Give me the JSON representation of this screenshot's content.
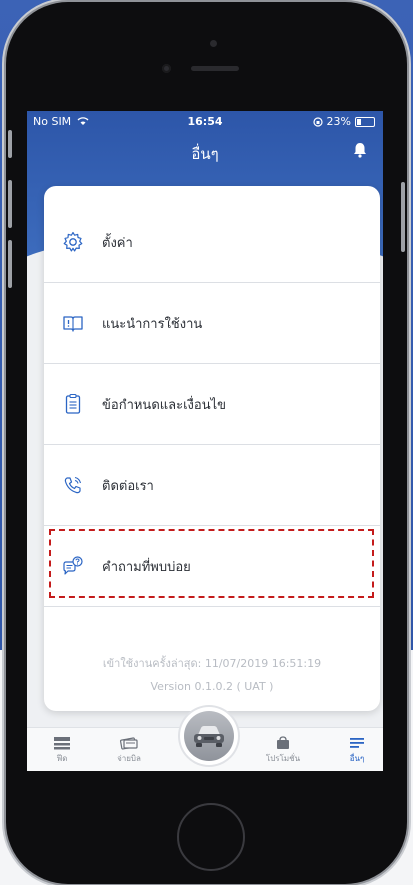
{
  "status_bar": {
    "carrier": "No SIM",
    "time": "16:54",
    "battery": "23%"
  },
  "header": {
    "title": "อื่นๆ"
  },
  "menu": {
    "items": [
      {
        "label": "ตั้งค่า",
        "icon": "gear-icon"
      },
      {
        "label": "แนะนำการใช้งาน",
        "icon": "book-icon"
      },
      {
        "label": "ข้อกำหนดและเงื่อนไข",
        "icon": "clipboard-icon"
      },
      {
        "label": "ติดต่อเรา",
        "icon": "phone-icon"
      },
      {
        "label": "คำถามที่พบบ่อย",
        "icon": "faq-chat-icon"
      }
    ]
  },
  "footer": {
    "last_login": "เข้าใช้งานครั้งล่าสุด: 11/07/2019 16:51:19",
    "version": "Version 0.1.0.2 ( UAT )"
  },
  "tabbar": {
    "feed": "ฟีด",
    "pay_bill": "จ่ายบิล",
    "promotions": "โปรโมชั่น",
    "more": "อื่นๆ"
  },
  "colors": {
    "primary": "#2d56a9",
    "accent": "#2b65c4",
    "highlight": "#c41b1b"
  }
}
